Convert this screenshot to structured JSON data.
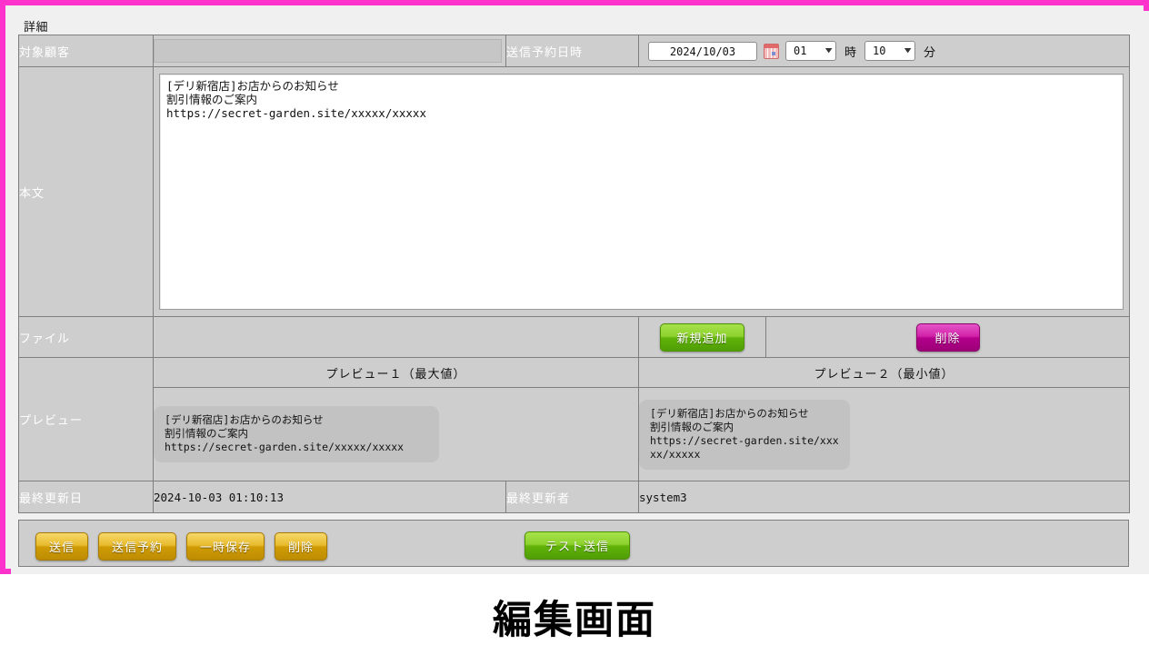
{
  "panel": {
    "title": "詳細"
  },
  "rows": {
    "target_customer": {
      "label": "対象顧客",
      "value": ""
    },
    "schedule": {
      "label": "送信予約日時",
      "date_value": "2024/10/03",
      "calendar_icon": "calendar-icon",
      "hour_value": "01",
      "hour_unit": "時",
      "minute_value": "10",
      "minute_unit": "分",
      "caret": "▼"
    },
    "body": {
      "label": "本文",
      "value": "[デリ新宿店]お店からのお知らせ\n割引情報のご案内\nhttps://secret-garden.site/xxxxx/xxxxx"
    },
    "file": {
      "label": "ファイル",
      "add_label": "新規追加",
      "delete_label": "削除"
    },
    "preview": {
      "label": "プレビュー",
      "header_1": "プレビュー１（最大値）",
      "header_2": "プレビュー２（最小値）",
      "text_1": "[デリ新宿店]お店からのお知らせ\n割引情報のご案内\nhttps://secret-garden.site/xxxxx/xxxxx",
      "text_2": "[デリ新宿店]お店からのお知らせ\n割引情報のご案内\nhttps://secret-garden.site/xxx\nxx/xxxxx"
    },
    "updated": {
      "date_label": "最終更新日",
      "date_value": "2024-10-03 01:10:13",
      "user_label": "最終更新者",
      "user_value": "system3"
    }
  },
  "footer": {
    "send_label": "送信",
    "schedule_send_label": "送信予約",
    "temp_save_label": "一時保存",
    "delete_label": "削除",
    "test_send_label": "テスト送信"
  },
  "caption": {
    "text": "編集画面"
  },
  "colors": {
    "frame_highlight": "#ff33cc",
    "label_green": "#6ba06b",
    "cell_gray": "#cecece",
    "button_green": "#62b309",
    "button_magenta": "#b4008c",
    "button_gold": "#cf9c05"
  }
}
